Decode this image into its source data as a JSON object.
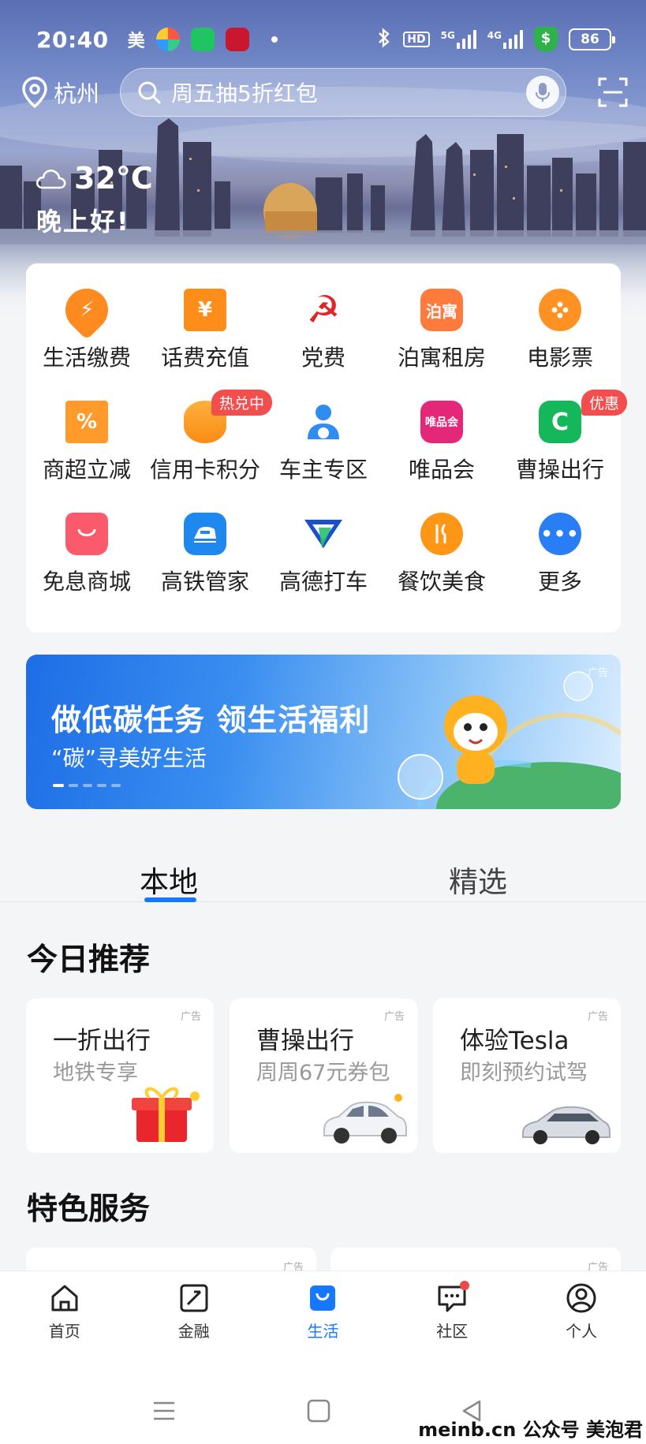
{
  "status": {
    "time": "20:40",
    "app_char": "美",
    "battery": "86",
    "net_5g": "5G",
    "net_4g": "4G",
    "hd": "HD"
  },
  "header": {
    "city": "杭州",
    "search_placeholder": "周五抽5折红包",
    "temperature": "32°C",
    "greeting": "晚上好!"
  },
  "grid": [
    {
      "label": "生活缴费",
      "icon": "bolt-icon",
      "badge": ""
    },
    {
      "label": "话费充值",
      "icon": "yuan-icon",
      "badge": ""
    },
    {
      "label": "党费",
      "icon": "hammer-sickle-icon",
      "badge": ""
    },
    {
      "label": "泊寓租房",
      "icon": "boyu-icon",
      "badge": ""
    },
    {
      "label": "电影票",
      "icon": "film-reel-icon",
      "badge": ""
    },
    {
      "label": "商超立减",
      "icon": "coupon-percent-icon",
      "badge": ""
    },
    {
      "label": "信用卡积分",
      "icon": "coins-icon",
      "badge": "热兑中"
    },
    {
      "label": "车主专区",
      "icon": "car-owner-icon",
      "badge": ""
    },
    {
      "label": "唯品会",
      "icon": "vip-icon",
      "badge": ""
    },
    {
      "label": "曹操出行",
      "icon": "caocao-icon",
      "badge": "优惠"
    },
    {
      "label": "免息商城",
      "icon": "shopping-bag-icon",
      "badge": ""
    },
    {
      "label": "高铁管家",
      "icon": "train-icon",
      "badge": ""
    },
    {
      "label": "高德打车",
      "icon": "amap-icon",
      "badge": ""
    },
    {
      "label": "餐饮美食",
      "icon": "food-icon",
      "badge": ""
    },
    {
      "label": "更多",
      "icon": "more-icon",
      "badge": ""
    }
  ],
  "banner": {
    "title": "做低碳任务 领生活福利",
    "subtitle": "“碳”寻美好生活",
    "ad": "广告"
  },
  "tabs": {
    "local": "本地",
    "featured": "精选"
  },
  "today": {
    "title": "今日推荐",
    "cards": [
      {
        "title": "一折出行",
        "subtitle": "地铁专享",
        "ad": "广告"
      },
      {
        "title": "曹操出行",
        "subtitle": "周周67元券包",
        "ad": "广告"
      },
      {
        "title": "体验Tesla",
        "subtitle": "即刻预约试驾",
        "ad": "广告"
      }
    ]
  },
  "special": {
    "title": "特色服务",
    "ad1": "广告",
    "ad2": "广告"
  },
  "nav": [
    {
      "label": "首页",
      "icon": "home-icon"
    },
    {
      "label": "金融",
      "icon": "finance-icon"
    },
    {
      "label": "生活",
      "icon": "life-bag-icon"
    },
    {
      "label": "社区",
      "icon": "chat-icon"
    },
    {
      "label": "个人",
      "icon": "profile-icon"
    }
  ],
  "watermark": "meinb.cn  公众号 美泡君",
  "colors": {
    "accent": "#1677ff",
    "badge": "#f24e4e",
    "background": "#f4f5f7"
  }
}
